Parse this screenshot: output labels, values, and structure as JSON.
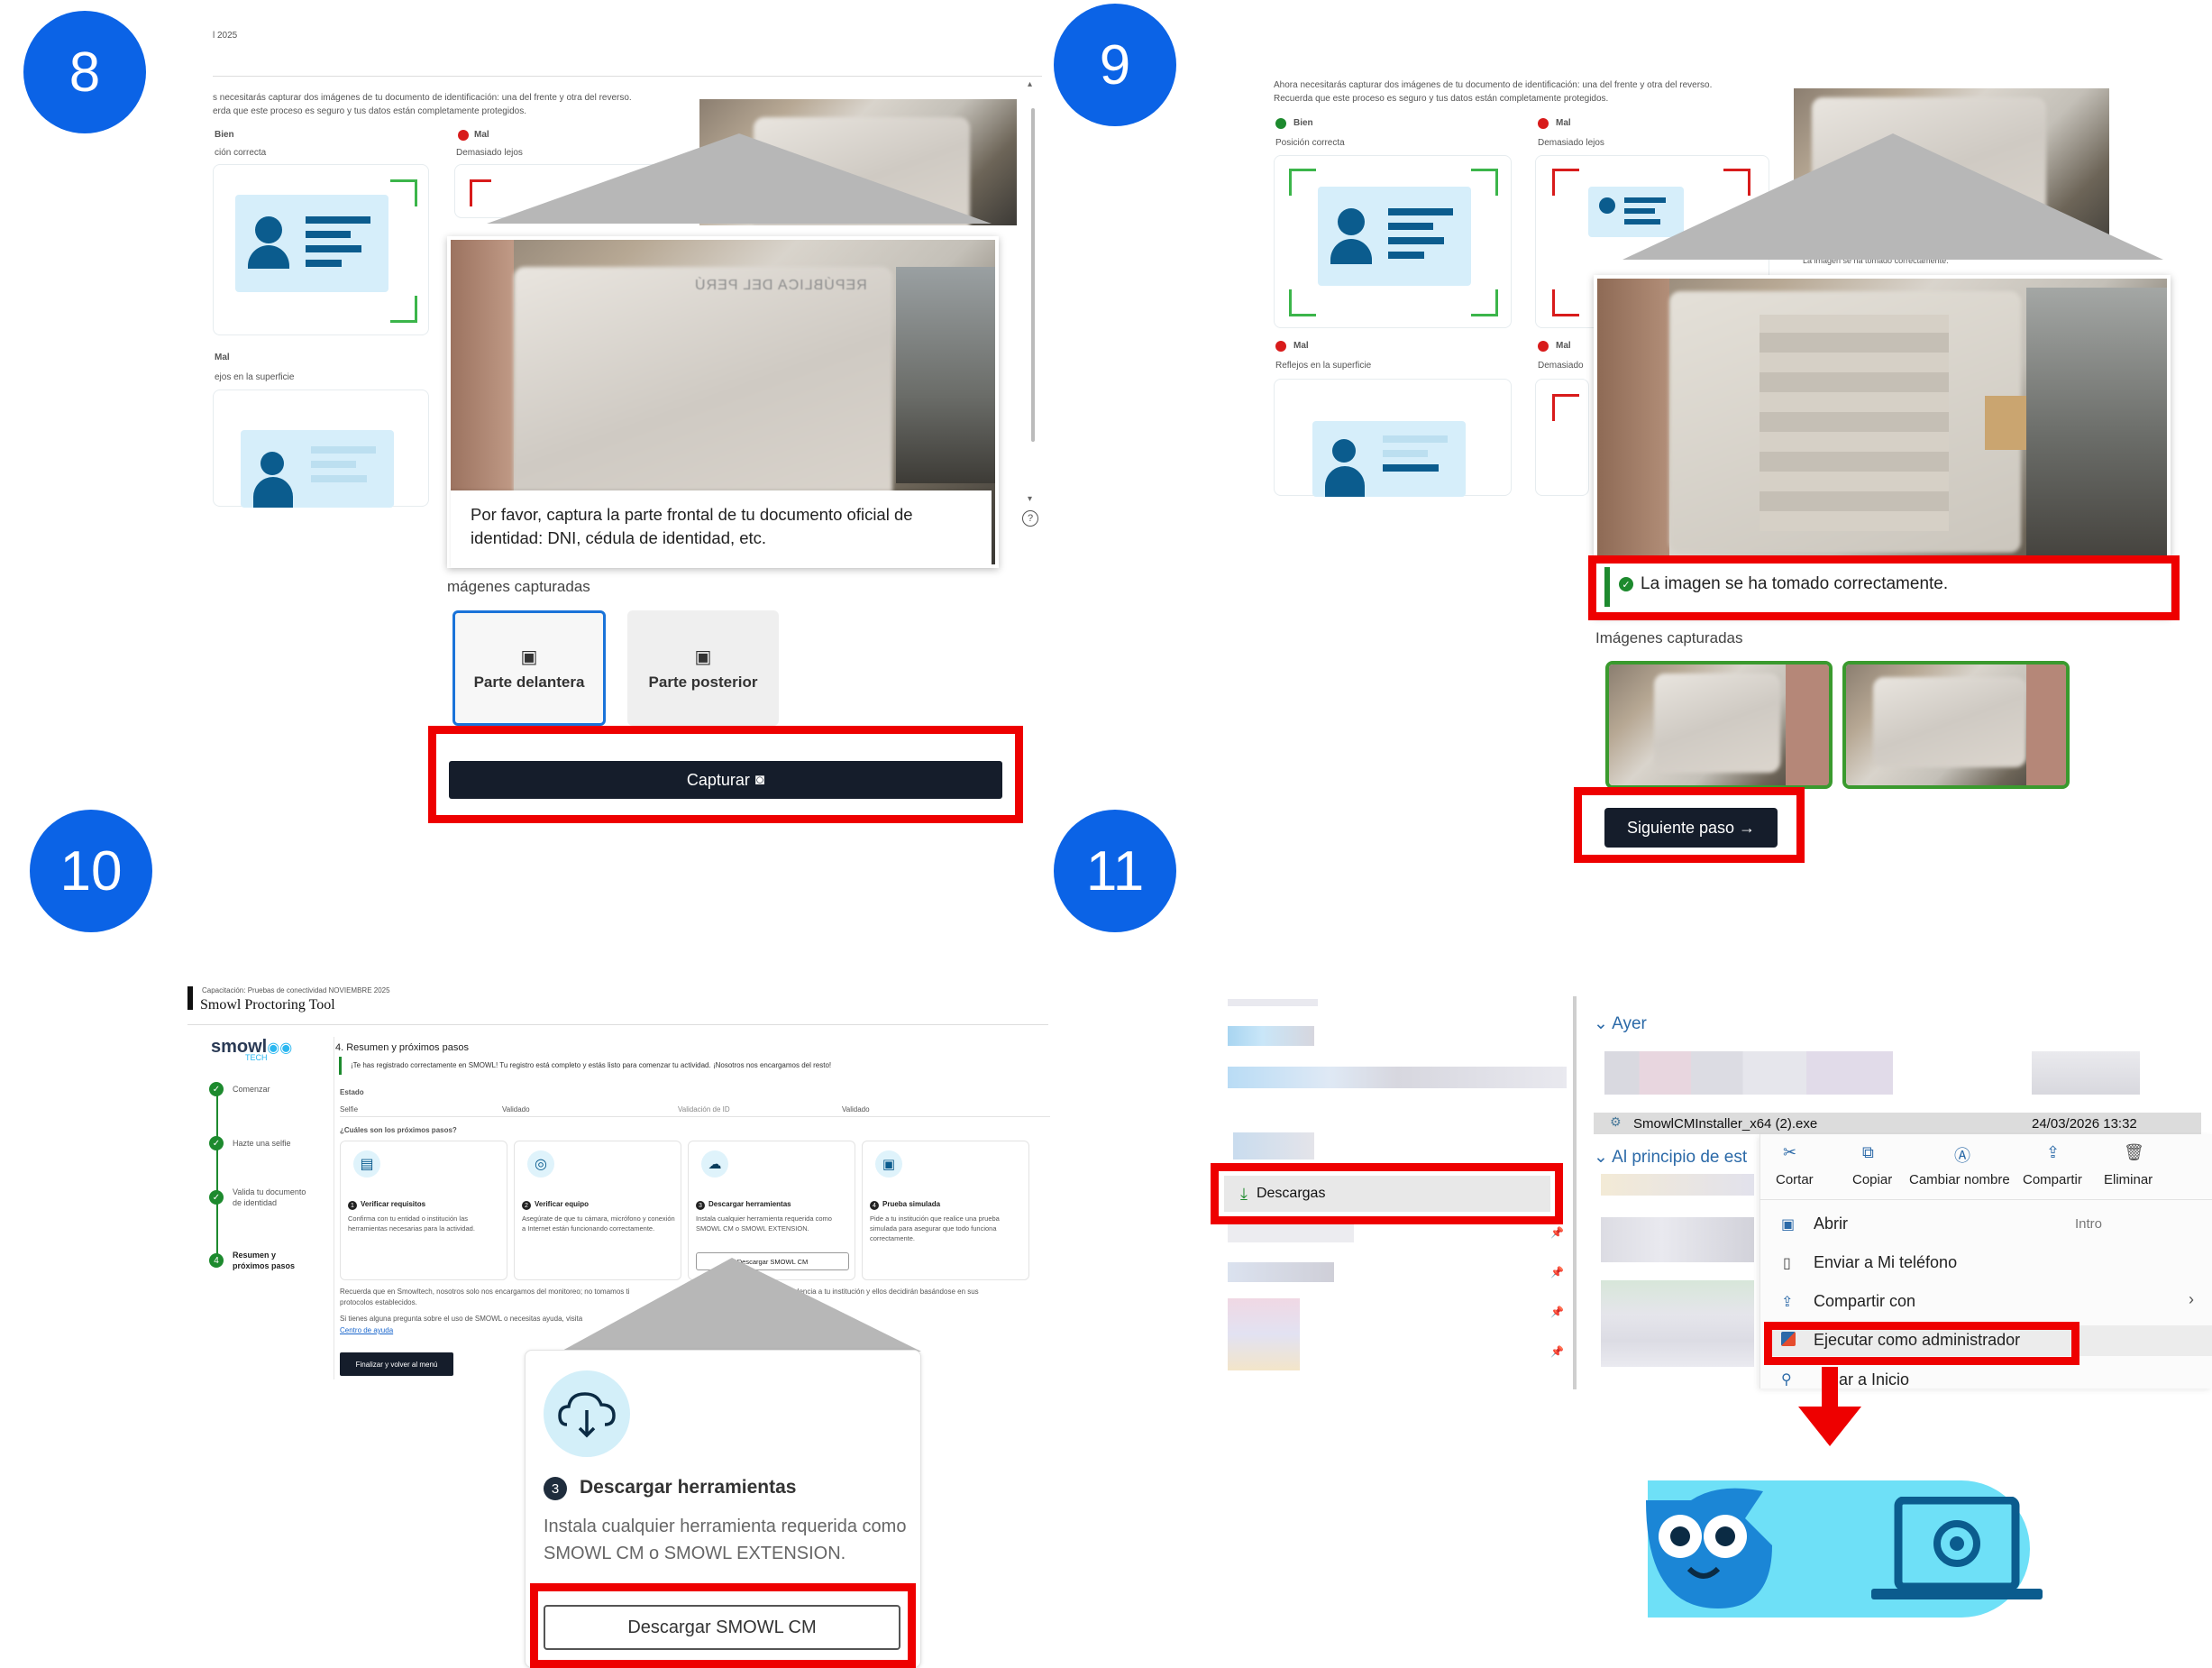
{
  "badges": [
    "8",
    "9",
    "10",
    "11"
  ],
  "panel8": {
    "date_fragment": "l 2025",
    "intro_line1": "s necesitarás capturar dos imágenes de tu documento de identificación: una del frente y otra del reverso.",
    "intro_line2": "erda que este proceso es seguro y tus datos están completamente protegidos.",
    "good_label": "Bien",
    "good_sub": "ción correcta",
    "bad1_label": "Mal",
    "bad1_sub": "Demasiado lejos",
    "bad2_label": "Mal",
    "bad2_sub": "ejos en la superficie",
    "instruction": "Por favor, captura la parte frontal de tu documento oficial de identidad: DNI, cédula de identidad, etc.",
    "captured_heading": "mágenes capturadas",
    "front_label": "Parte delantera",
    "back_label": "Parte posterior",
    "capture_button": "Capturar",
    "card_text": "REPÚBLICA DEL PERÚ"
  },
  "panel9": {
    "intro_line1": "Ahora necesitarás capturar dos imágenes de tu documento de identificación: una del frente y otra del reverso.",
    "intro_line2": "Recuerda que este proceso es seguro y tus datos están completamente protegidos.",
    "good_label": "Bien",
    "good_sub": "Posición correcta",
    "bad1_label": "Mal",
    "bad1_sub": "Demasiado lejos",
    "bad2_label": "Mal",
    "bad2_sub": "Reflejos en la superficie",
    "bad3_label": "Mal",
    "bad3_sub": "Demasiado",
    "small_success": "La imagen se ha tomado correctamente.",
    "success_message": "La imagen se ha tomado correctamente.",
    "captured_heading": "Imágenes capturadas",
    "next_button": "Siguiente paso →"
  },
  "panel10": {
    "course": "Capacitación: Pruebas de conectividad NOVIEMBRE 2025",
    "title": "Smowl Proctoring Tool",
    "logo": "smowl",
    "logo_sub": "TECH",
    "section_title": "4. Resumen y próximos pasos",
    "registered_msg": "¡Te has registrado correctamente en SMOWL! Tu registro está completo y estás listo para comenzar tu actividad. ¡Nosotros nos encargamos del resto!",
    "status_heading": "Estado",
    "status_rows": [
      {
        "label": "Selfie",
        "value": "Validado"
      },
      {
        "label": "Validación de ID",
        "value": "Validado"
      }
    ],
    "next_steps_heading": "¿Cuáles son los próximos pasos?",
    "steps_nav": [
      "Comenzar",
      "Hazte una selfie",
      "Valida tu documento de identidad",
      "Resumen y próximos pasos"
    ],
    "cards": [
      {
        "num": "1",
        "title": "Verificar requisitos",
        "body": "Confirma con tu entidad o institución las herramientas necesarias para la actividad."
      },
      {
        "num": "2",
        "title": "Verificar equipo",
        "body": "Asegúrate de que tu cámara, micrófono y conexión a Internet están funcionando correctamente."
      },
      {
        "num": "3",
        "title": "Descargar herramientas",
        "body": "Instala cualquier herramienta requerida como SMOWL CM o SMOWL EXTENSION."
      },
      {
        "num": "4",
        "title": "Prueba simulada",
        "body": "Pide a tu institución que realice una prueba simulada para asegurar que todo funciona correctamente."
      }
    ],
    "small_download_btn": "Descargar SMOWL CM",
    "footer1": "Recuerda que en Smowltech, nosotros solo nos encargamos del monitoreo; no tomamos ti",
    "footer1_end": "dencia a tu institución y ellos decidirán basándose en sus",
    "footer1b": "protocolos establecidos.",
    "footer2": "Si tienes alguna pregunta sobre el uso de SMOWL o necesitas ayuda, visita",
    "help_link": "Centro de ayuda",
    "finish_button": "Finalizar y volver al menú",
    "zoom_num": "3",
    "zoom_title": "Descargar herramientas",
    "zoom_body": "Instala cualquier herramienta requerida como SMOWL CM o SMOWL EXTENSION.",
    "zoom_button": "Descargar SMOWL CM"
  },
  "panel11": {
    "group_yesterday": "Ayer",
    "file_name": "SmowlCMInstaller_x64 (2).exe",
    "file_date": "24/03/2026 13:32",
    "group_earlier": "Al principio de est",
    "downloads_label": "Descargas",
    "toolbar": [
      "Cortar",
      "Copiar",
      "Cambiar nombre",
      "Compartir",
      "Eliminar"
    ],
    "menu": [
      {
        "label": "Abrir",
        "shortcut": "Intro"
      },
      {
        "label": "Enviar a Mi teléfono",
        "shortcut": ""
      },
      {
        "label": "Compartir con",
        "shortcut": "›"
      },
      {
        "label": "Ejecutar como administrador",
        "shortcut": ""
      },
      {
        "label": "ar a Inicio",
        "shortcut": ""
      }
    ]
  },
  "colors": {
    "badge": "#0b63e6",
    "highlight": "#ee0000",
    "dark_button": "#151d2b",
    "success": "#1d8a2e"
  }
}
